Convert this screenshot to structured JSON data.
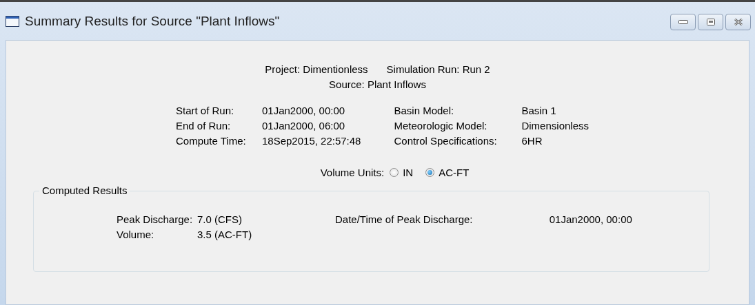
{
  "window": {
    "title": "Summary Results for Source \"Plant Inflows\""
  },
  "header": [
    {
      "label": "Project:",
      "value": "Dimentionless"
    },
    {
      "label": "Simulation Run:",
      "value": "Run 2"
    },
    {
      "label": "Source:",
      "value": "Plant Inflows"
    }
  ],
  "run_info": {
    "left": [
      {
        "label": "Start of Run:",
        "value": "01Jan2000, 00:00"
      },
      {
        "label": "End of Run:",
        "value": "01Jan2000, 06:00"
      },
      {
        "label": "Compute Time:",
        "value": "18Sep2015, 22:57:48"
      }
    ],
    "right": [
      {
        "label": "Basin Model:",
        "value": "Basin 1"
      },
      {
        "label": "Meteorologic Model:",
        "value": "Dimensionless"
      },
      {
        "label": "Control Specifications:",
        "value": "6HR"
      }
    ]
  },
  "volume_units": {
    "label": "Volume Units:",
    "options": [
      {
        "label": "IN",
        "selected": false
      },
      {
        "label": "AC-FT",
        "selected": true
      }
    ]
  },
  "computed_results": {
    "title": "Computed Results",
    "rows": [
      {
        "label": "Peak Discharge:",
        "value": "7.0 (CFS)",
        "extra_label": "Date/Time of Peak Discharge:",
        "extra_value": "01Jan2000, 00:00"
      },
      {
        "label": "Volume:",
        "value": "3.5 (AC-FT)"
      }
    ]
  }
}
